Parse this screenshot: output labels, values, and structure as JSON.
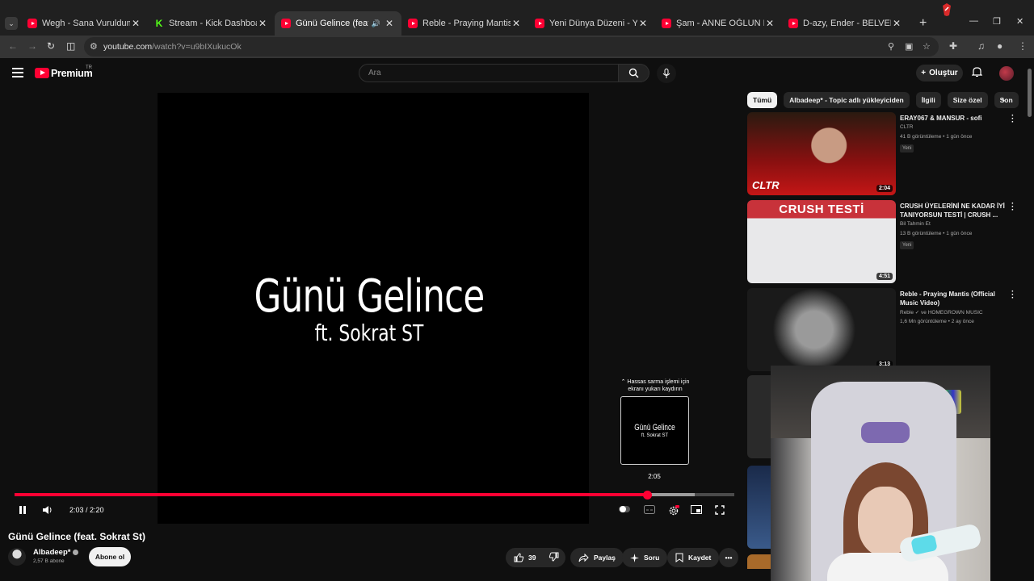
{
  "browser": {
    "tabs": [
      {
        "title": "Wegh - Sana Vuruldum / Ulubey",
        "icon": "youtube-icon",
        "active": false
      },
      {
        "title": "Stream - Kick Dashboard",
        "icon": "kick-icon",
        "active": false
      },
      {
        "title": "Günü Gelince (feat. Sokrat St)",
        "icon": "youtube-icon",
        "active": true
      },
      {
        "title": "Reble - Praying Mantis (Official",
        "icon": "youtube-icon",
        "active": false
      },
      {
        "title": "Yeni Dünya Düzeni - YouTube",
        "icon": "youtube-icon",
        "active": false
      },
      {
        "title": "Şam - ANNE OĞLUN RAPSTAR",
        "icon": "youtube-icon",
        "active": false
      },
      {
        "title": "D-azy, Ender - BELVEDERE (Pro",
        "icon": "youtube-icon",
        "active": false
      }
    ],
    "url_host": "youtube.com",
    "url_path": "/watch?v=u9bIXukucOk"
  },
  "masthead": {
    "brand": "Premium",
    "country": "TR",
    "search_placeholder": "Ara",
    "create_label": "Oluştur"
  },
  "player": {
    "title_line": "Günü Gelince",
    "sub_line": "ft. Sokrat ST",
    "seek_hint": "⌃ Hassas sarma işlemi için ekranı yukarı kaydırın",
    "seek_thumb_title": "Günü Gelince",
    "seek_thumb_sub": "ft. Sokrat ST",
    "seek_time": "2:05",
    "time_display": "2:03 / 2:20",
    "progress_fraction": 0.879,
    "buffer_fraction": 0.945
  },
  "watch": {
    "title": "Günü Gelince (feat. Sokrat St)",
    "channel": "Albadeep*",
    "subscribers": "2,57 B abone",
    "subscribe_label": "Abone ol",
    "likes": "39",
    "share_label": "Paylaş",
    "ask_label": "Soru",
    "save_label": "Kaydet"
  },
  "sidebar": {
    "chips": [
      "Tümü",
      "Albadeep* - Topic adlı yükleyiciden",
      "İlgili",
      "Size özel",
      "Son"
    ],
    "recs": [
      {
        "title": "ERAY067 & MANSUR - sofi",
        "channel": "CLTR",
        "meta": "41 B görüntüleme • 1 gün önce",
        "badge": "Yeni",
        "duration": "2:04",
        "thumb_text": "CLTR"
      },
      {
        "title": "CRUSH ÜYELERİNİ NE KADAR İYİ TANIYORSUN TESTİ | CRUSH ...",
        "channel": "Bil Tahmin Et",
        "meta": "13 B görüntüleme • 1 gün önce",
        "badge": "Yeni",
        "duration": "4:51",
        "thumb_text": "CRUSH TESTİ"
      },
      {
        "title": "Reble - Praying Mantis (Official Music Video)",
        "channel": "Reble ✓ ve HOMEGROWN MUSIC",
        "meta": "1,6 Mn görüntüleme • 2 ay önce",
        "badge": "",
        "duration": "3:13",
        "thumb_text": ""
      }
    ]
  }
}
